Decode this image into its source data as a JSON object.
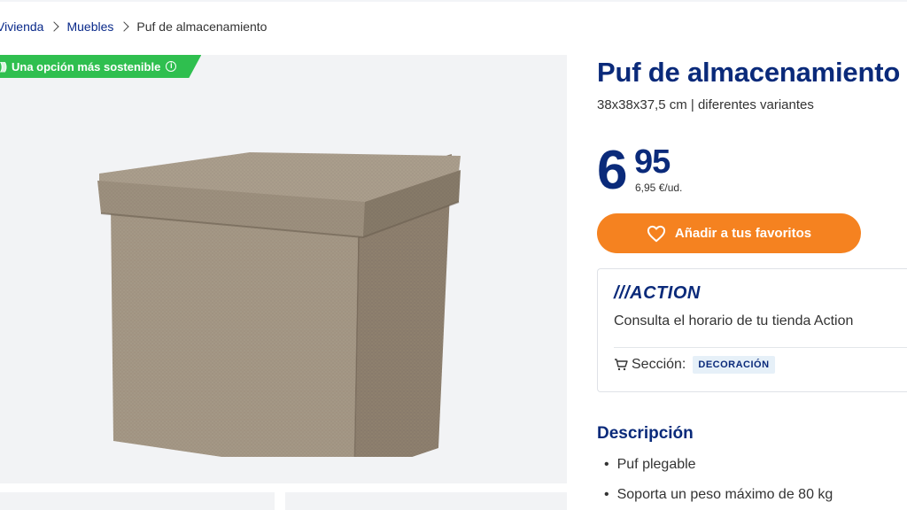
{
  "breadcrumb": {
    "items": [
      "Vivienda",
      "Muebles"
    ],
    "current": "Puf de almacenamiento"
  },
  "gallery": {
    "eco_badge": "Una opción más sostenible",
    "eco_icon": "leaf-signal-icon",
    "info_icon": "info-icon",
    "info_glyph": "i",
    "image": "storage-ottoman-beige"
  },
  "product": {
    "title": "Puf de almacenamiento",
    "subtitle": "38x38x37,5 cm | diferentes variantes",
    "price_int": "6",
    "price_dec": "95",
    "price_unit": "6,95 €/ud."
  },
  "favorites_button": {
    "label": "Añadir a tus favoritos",
    "icon": "heart-icon",
    "color": "#f58220"
  },
  "store": {
    "logo": "///ACTION",
    "hours_text": "Consulta el horario de tu tienda Action",
    "section_label": "Sección:",
    "section_value": "DECORACIÓN",
    "section_icon": "cart-icon"
  },
  "description": {
    "title": "Descripción",
    "items": [
      "Puf plegable",
      "Soporta un peso máximo de 80 kg"
    ]
  },
  "colors": {
    "brand_blue": "#0a2a7a",
    "eco_green": "#2fbf4f",
    "orange": "#f58220"
  }
}
